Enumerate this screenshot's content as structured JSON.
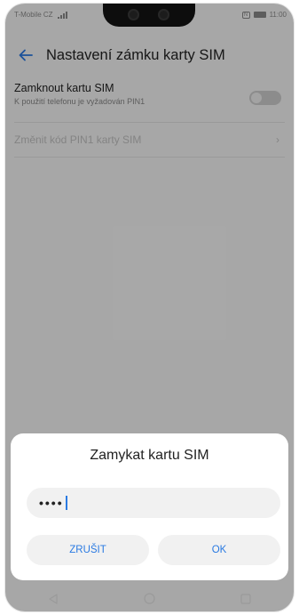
{
  "status_bar": {
    "carrier": "T-Mobile CZ",
    "time": "11:00",
    "icons": [
      "signal-icon",
      "nfc-icon",
      "battery-icon"
    ]
  },
  "header": {
    "title": "Nastavení zámku karty SIM",
    "back_icon": "back-arrow-icon"
  },
  "settings": {
    "lock_sim": {
      "title": "Zamknout kartu SIM",
      "subtitle": "K použití telefonu je vyžadován PIN1",
      "enabled": false
    },
    "change_pin": {
      "label": "Změnit kód PIN1 karty SIM",
      "icon": "chevron-right-icon",
      "disabled": true
    }
  },
  "dialog": {
    "title": "Zamykat kartu SIM",
    "pin_value": "••••",
    "cancel_label": "ZRUŠIT",
    "ok_label": "OK"
  },
  "nav_bar": {
    "icons": [
      "back-triangle-icon",
      "home-circle-icon",
      "recents-square-icon"
    ]
  },
  "colors": {
    "accent": "#2a7ae2",
    "background": "#f7f7f7",
    "dialog_bg": "#ffffff",
    "field_bg": "#f1f1f1"
  }
}
